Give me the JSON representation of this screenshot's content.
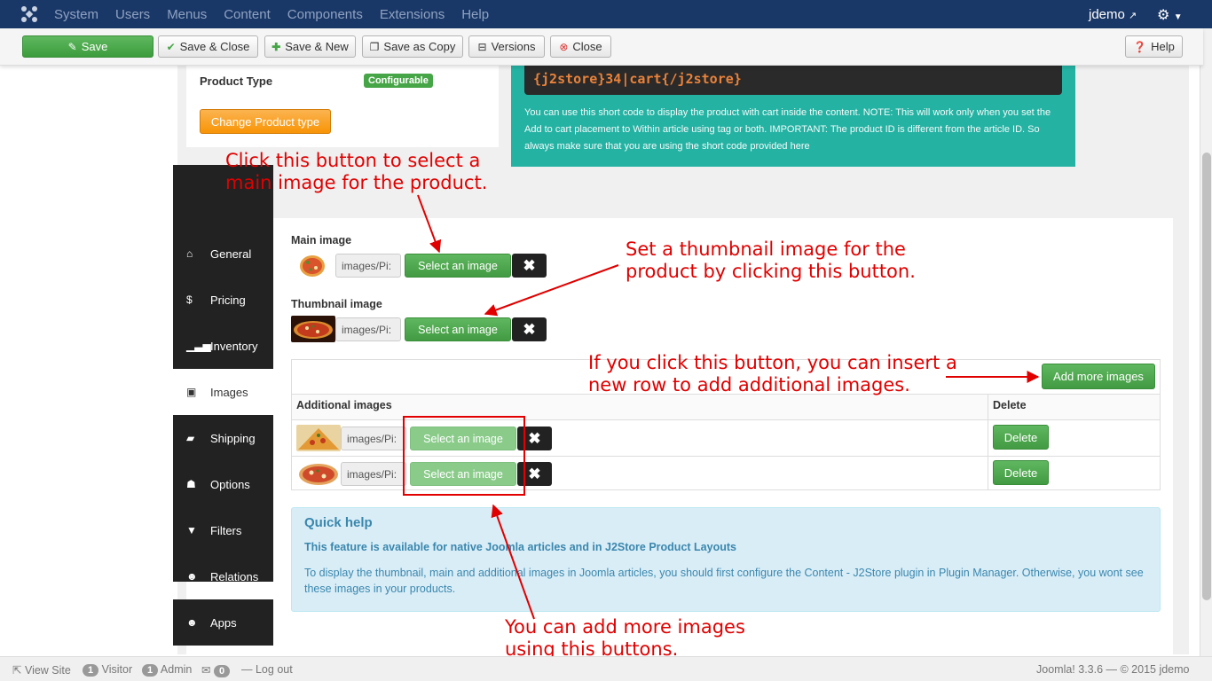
{
  "navbar": {
    "menu": [
      "System",
      "Users",
      "Menus",
      "Content",
      "Components",
      "Extensions",
      "Help"
    ],
    "user": "jdemo"
  },
  "toolbar": {
    "save": "Save",
    "save_close": "Save & Close",
    "save_new": "Save & New",
    "save_copy": "Save as Copy",
    "versions": "Versions",
    "close": "Close",
    "help": "Help"
  },
  "product": {
    "type_label": "Product Type",
    "type_value": "Configurable",
    "change_button": "Change Product type",
    "shortcode": "{j2store}34|cart{/j2store}",
    "shortcode_note": "You can use this short code to display the product with cart inside the content. NOTE: This will work only when you set the Add to cart placement to Within article using tag or both. IMPORTANT: The product ID is different from the article ID. So always make sure that you are using the short code provided here"
  },
  "tabs": [
    "General",
    "Pricing",
    "Inventory",
    "Images",
    "Shipping",
    "Options",
    "Filters",
    "Relations",
    "Apps"
  ],
  "images": {
    "main_label": "Main image",
    "thumb_label": "Thumbnail image",
    "path_value": "images/Pi:",
    "select_label": "Select an image",
    "remove_symbol": "✖",
    "add_more": "Add more images",
    "additional_header": "Additional images",
    "delete_header": "Delete",
    "delete_label": "Delete"
  },
  "quick_help": {
    "title": "Quick help",
    "subtitle": "This feature is available for native Joomla articles and in J2Store Product Layouts",
    "text": "To display the thumbnail, main and additional images in Joomla articles, you should first configure the Content - J2Store plugin in Plugin Manager. Otherwise, you wont see these images in your products."
  },
  "annotations": {
    "a1_line1": "Click this button to select a",
    "a1_line2": "main image for the product.",
    "a2_line1": "Set a thumbnail image for the",
    "a2_line2": "product by clicking this button.",
    "a3_line1": "If you click this button, you can insert a",
    "a3_line2": "new row to add additional images.",
    "a4_line1": "You can add more images",
    "a4_line2": "using this buttons."
  },
  "footer": {
    "view_site": "View Site",
    "visitor_count": "1",
    "visitor": "Visitor",
    "admin_count": "1",
    "admin": "Admin",
    "msg_count": "0",
    "logout": "Log out",
    "version": "Joomla! 3.3.6 — © 2015 jdemo"
  },
  "colors": {
    "navbar": "#1a3867",
    "accent_green": "#46a546",
    "teal": "#24b2a3",
    "annotation_red": "#e00000"
  }
}
